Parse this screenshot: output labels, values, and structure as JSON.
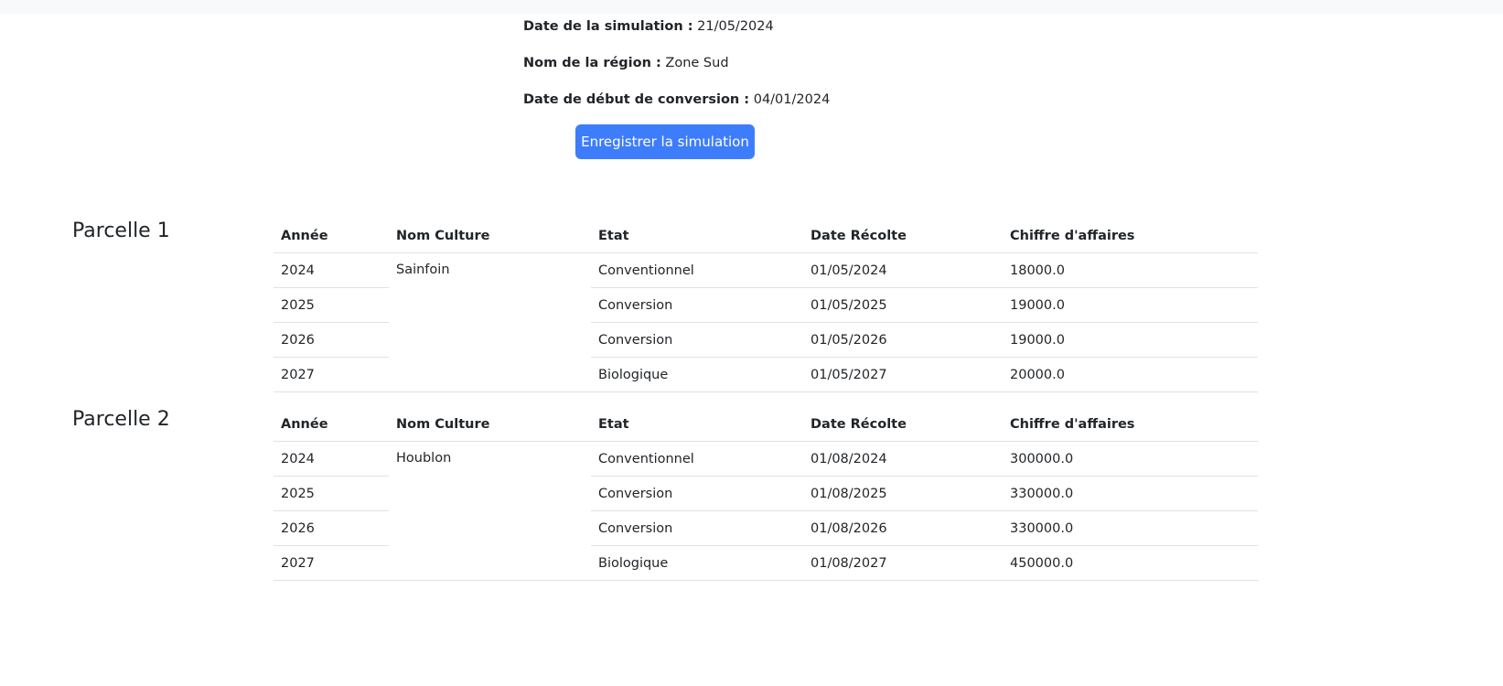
{
  "simulation": {
    "date_label": "Date de la simulation :",
    "date_value": "21/05/2024",
    "region_label": "Nom de la région :",
    "region_value": "Zone Sud",
    "conversion_label": "Date de début de conversion :",
    "conversion_value": "04/01/2024",
    "save_button": "Enregistrer la simulation"
  },
  "table_headers": {
    "year": "Année",
    "crop": "Nom Culture",
    "state": "Etat",
    "harvest": "Date Récolte",
    "revenue": "Chiffre d'affaires"
  },
  "parcels": [
    {
      "title": "Parcelle 1",
      "crop": "Sainfoin",
      "rows": [
        {
          "year": "2024",
          "state": "Conventionnel",
          "harvest": "01/05/2024",
          "revenue": "18000.0"
        },
        {
          "year": "2025",
          "state": "Conversion",
          "harvest": "01/05/2025",
          "revenue": "19000.0"
        },
        {
          "year": "2026",
          "state": "Conversion",
          "harvest": "01/05/2026",
          "revenue": "19000.0"
        },
        {
          "year": "2027",
          "state": "Biologique",
          "harvest": "01/05/2027",
          "revenue": "20000.0"
        }
      ]
    },
    {
      "title": "Parcelle 2",
      "crop": "Houblon",
      "rows": [
        {
          "year": "2024",
          "state": "Conventionnel",
          "harvest": "01/08/2024",
          "revenue": "300000.0"
        },
        {
          "year": "2025",
          "state": "Conversion",
          "harvest": "01/08/2025",
          "revenue": "330000.0"
        },
        {
          "year": "2026",
          "state": "Conversion",
          "harvest": "01/08/2026",
          "revenue": "330000.0"
        },
        {
          "year": "2027",
          "state": "Biologique",
          "harvest": "01/08/2027",
          "revenue": "450000.0"
        }
      ]
    }
  ]
}
